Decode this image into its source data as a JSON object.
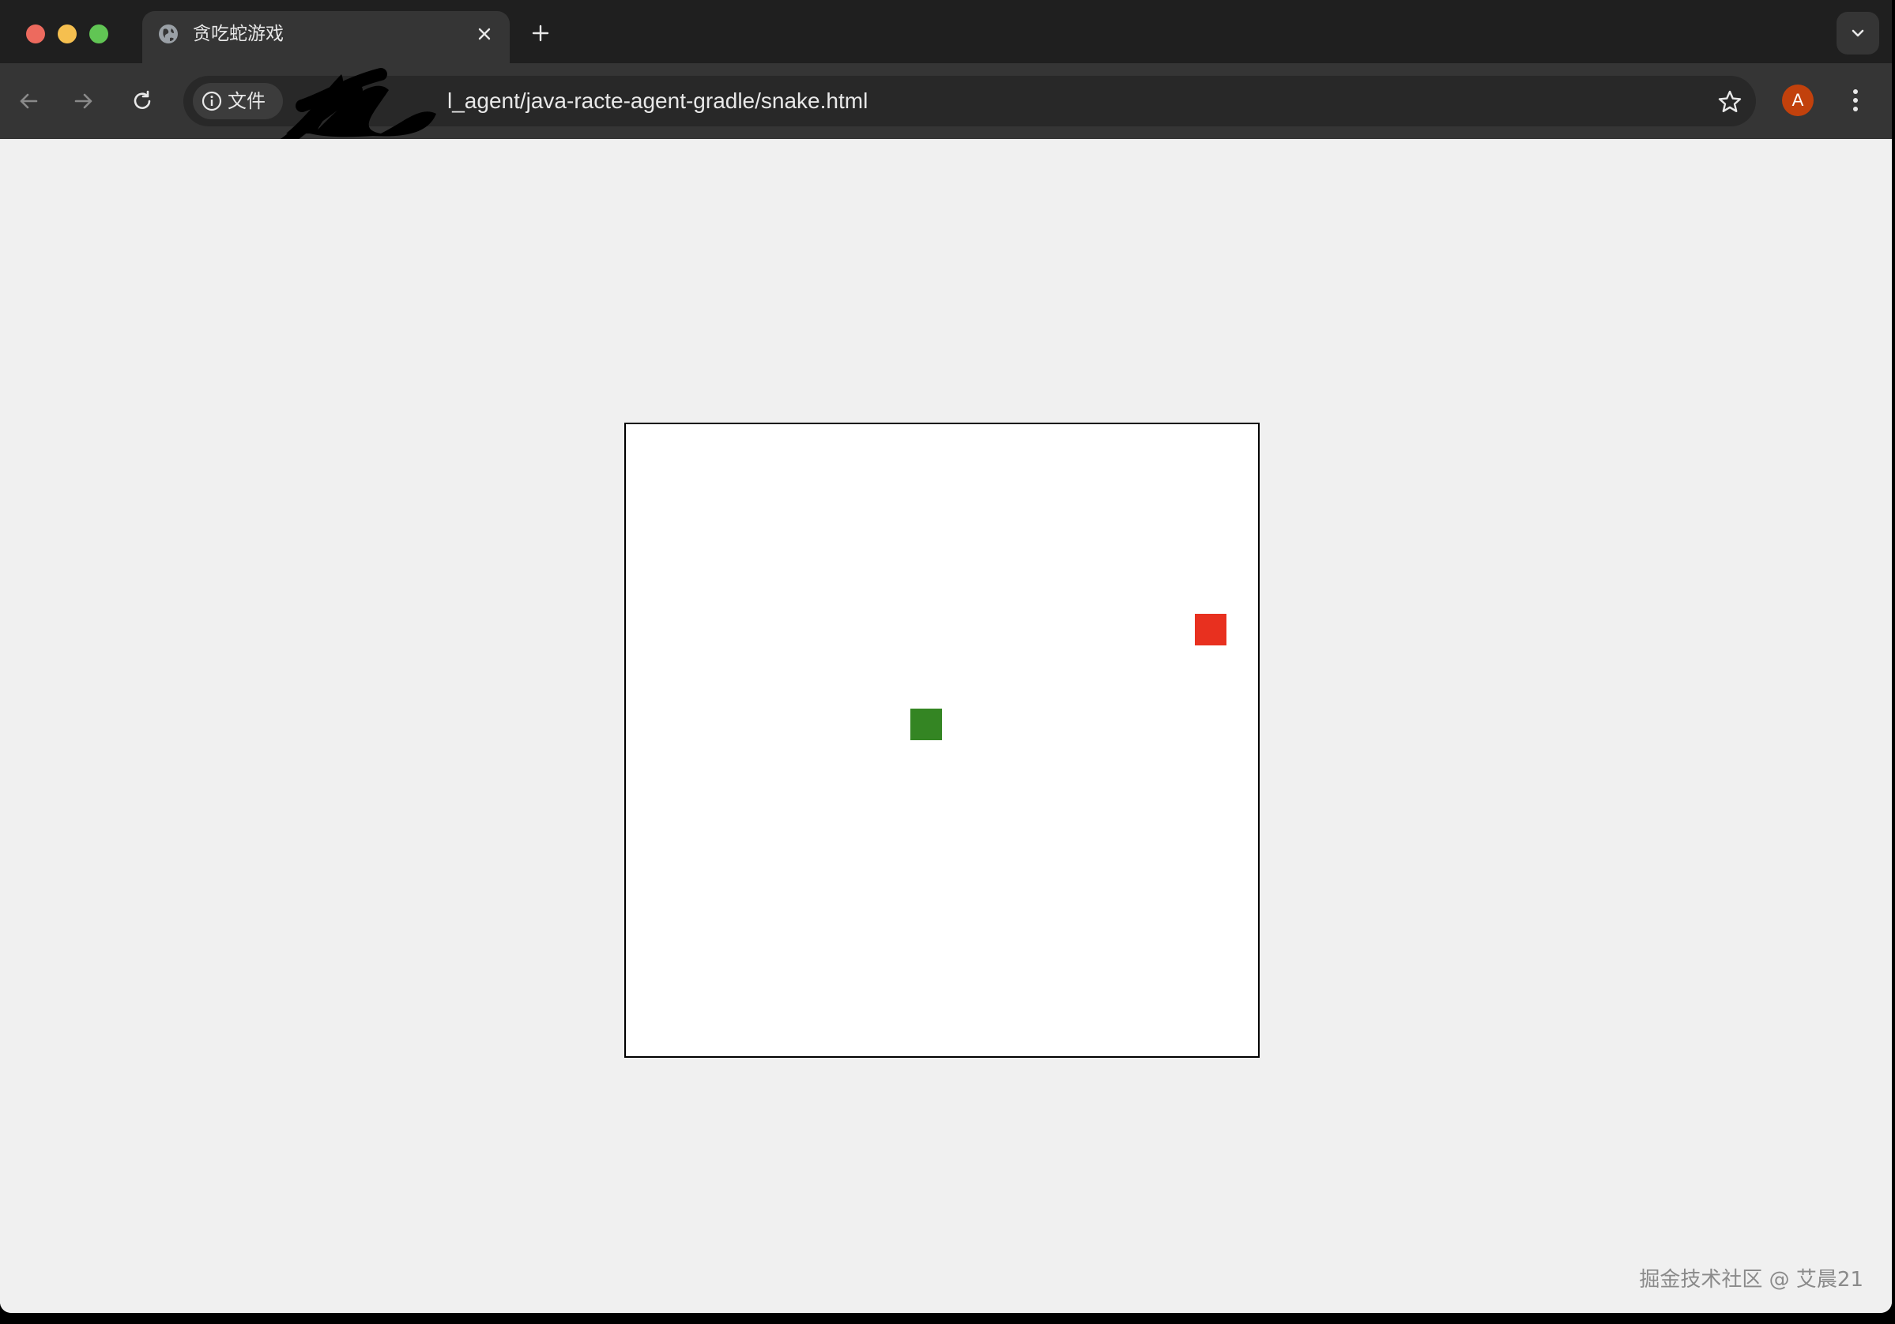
{
  "browser": {
    "tab": {
      "title": "贪吃蛇游戏",
      "favicon": "globe-icon"
    },
    "omnibox": {
      "site_chip_label": "文件",
      "url_visible": "l_agent/java-racte-agent-gradle/snake.html"
    },
    "profile_initial": "A"
  },
  "game": {
    "board_background": "#ffffff",
    "food": {
      "color": "#e8301f",
      "col": 18,
      "row": 6
    },
    "snake": {
      "color": "#348523",
      "segments": [
        {
          "col": 9,
          "row": 9
        }
      ]
    }
  },
  "watermark": "掘金技术社区 @ 艾晨21"
}
